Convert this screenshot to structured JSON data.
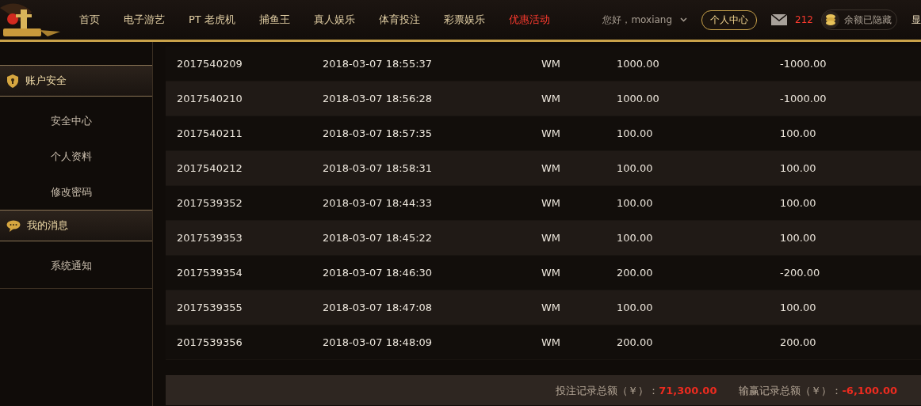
{
  "header": {
    "nav": [
      {
        "label": "首页",
        "selected": false
      },
      {
        "label": "电子游艺",
        "selected": false
      },
      {
        "label": "PT 老虎机",
        "selected": false
      },
      {
        "label": "捕鱼王",
        "selected": false
      },
      {
        "label": "真人娱乐",
        "selected": false
      },
      {
        "label": "体育投注",
        "selected": false
      },
      {
        "label": "彩票娱乐",
        "selected": false
      },
      {
        "label": "优惠活动",
        "selected": true
      }
    ],
    "greeting": "您好，moxiang",
    "account_button": "个人中心",
    "mail_count": "212",
    "balance": "余额已隐藏",
    "show_toggle": "显"
  },
  "sidebar": {
    "sections": [
      {
        "title": "账户安全",
        "expanded": true,
        "items": [
          "安全中心",
          "个人资料",
          "修改密码"
        ]
      },
      {
        "title": "我的消息",
        "expanded": true,
        "items": [
          "系统通知"
        ]
      }
    ]
  },
  "table": {
    "rows": [
      [
        "2017540209",
        "2018-03-07 18:55:37",
        "WM",
        "1000.00",
        "-1000.00"
      ],
      [
        "2017540210",
        "2018-03-07 18:56:28",
        "WM",
        "1000.00",
        "-1000.00"
      ],
      [
        "2017540211",
        "2018-03-07 18:57:35",
        "WM",
        "100.00",
        "100.00"
      ],
      [
        "2017540212",
        "2018-03-07 18:58:31",
        "WM",
        "100.00",
        "100.00"
      ],
      [
        "2017539352",
        "2018-03-07 18:44:33",
        "WM",
        "100.00",
        "100.00"
      ],
      [
        "2017539353",
        "2018-03-07 18:45:22",
        "WM",
        "100.00",
        "100.00"
      ],
      [
        "2017539354",
        "2018-03-07 18:46:30",
        "WM",
        "200.00",
        "-200.00"
      ],
      [
        "2017539355",
        "2018-03-07 18:47:08",
        "WM",
        "100.00",
        "100.00"
      ],
      [
        "2017539356",
        "2018-03-07 18:48:09",
        "WM",
        "200.00",
        "200.00"
      ]
    ]
  },
  "summary": [
    {
      "label": "投注记录总额（￥）：",
      "value": "71,300.00"
    },
    {
      "label": "输赢记录总额（￥）：",
      "value": "-6,100.00"
    }
  ]
}
